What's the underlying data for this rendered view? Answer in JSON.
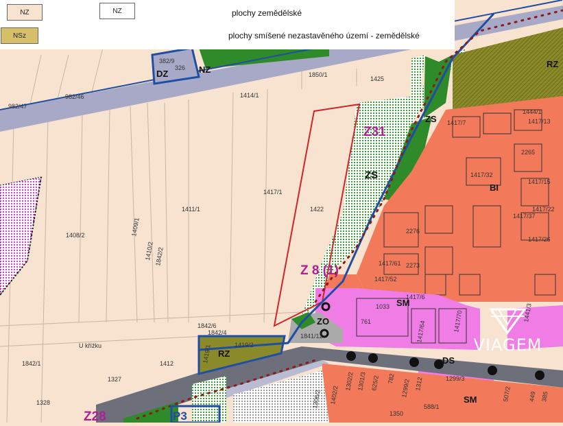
{
  "legend": {
    "items": [
      {
        "code": "NZ",
        "color": "#f7e3cf",
        "label": "plochy zemědělské"
      },
      {
        "code": "NSz",
        "color": "#d7bf6a",
        "label": "plochy smíšené nezastavěného území - zemědělské"
      }
    ],
    "swatch_secondary": "NZ"
  },
  "zones": {
    "z31": "Z31",
    "z8": "Z 8 (1)",
    "z28": "Z28",
    "p3": "P3",
    "zs_top": "ZS",
    "zs_mid": "ZS",
    "rz_top": "RZ",
    "rz_bottom": "RZ",
    "dz": "DZ",
    "nz": "NZ",
    "bi": "BI",
    "sm1": "SM",
    "sm2": "SM",
    "ds": "DS",
    "zo": "ZO"
  },
  "parcels": {
    "p1850_1": "1850/1",
    "p1425": "1425",
    "p1414_1": "1414/1",
    "p1411_1": "1411/1",
    "p1417_1": "1417/1",
    "p1422": "1422",
    "p1408_2": "1408/2",
    "p1409_1": "1409/1",
    "p1410_2": "1410/2",
    "p1842_2": "1842/2",
    "p1842_6": "1842/6",
    "p1842_4": "1842/4",
    "p1841_12": "1841/12",
    "p1419_2": "1419/2",
    "p1419_1": "1419/1",
    "p1842_1": "1842/1",
    "p1412": "1412",
    "p1327": "1327",
    "p1328": "1328",
    "p1417_6": "1417/6",
    "p1033": "1033",
    "p761": "761",
    "p1417_64": "1417/64",
    "p1417_70": "1417/70",
    "p1417_7": "1417/7",
    "p1417_32": "1417/32",
    "p1417_61": "1417/61",
    "p1417_52": "1417/52",
    "p2273": "2273",
    "p2276": "2276",
    "p2265": "2265",
    "p1417_13": "1417/13",
    "p1417_15": "1417/15",
    "p1417_37": "1417/37",
    "p1417_22": "1417/22",
    "p1417_26": "1417/26",
    "p1444_1": "1444/1",
    "p1312": "1312",
    "p782": "782",
    "p1299_3": "1299/3",
    "p1350": "1350",
    "p507_2": "507/2",
    "p449": "449",
    "p385": "385",
    "p382_9": "382/9",
    "p326": "326",
    "p1402_2": "1402/2",
    "p1302_2": "1302/2",
    "p1301_3": "1301/3",
    "p625_2": "625/2",
    "p1299_2": "1299/2",
    "p588": "588/1",
    "p1306_2": "1306/2",
    "p982_47": "982/47",
    "p982_46": "982/46",
    "p1441": "1441/3",
    "u_krizku": "U křížku"
  },
  "watermark": {
    "text": "VIAGEM"
  },
  "colors": {
    "agricultural": "#f7e3cf",
    "mixed_agri": "#d7bf6a",
    "road": "#a7a9c6",
    "residential": "#f27a5a",
    "mixed_use": "#f07ce6",
    "greenery": "#2f8a2a",
    "olive": "#8b8a2a",
    "plan_red": "#d2222a",
    "boundary_blue": "#1f4ea3",
    "z_label": "#b01f96"
  }
}
